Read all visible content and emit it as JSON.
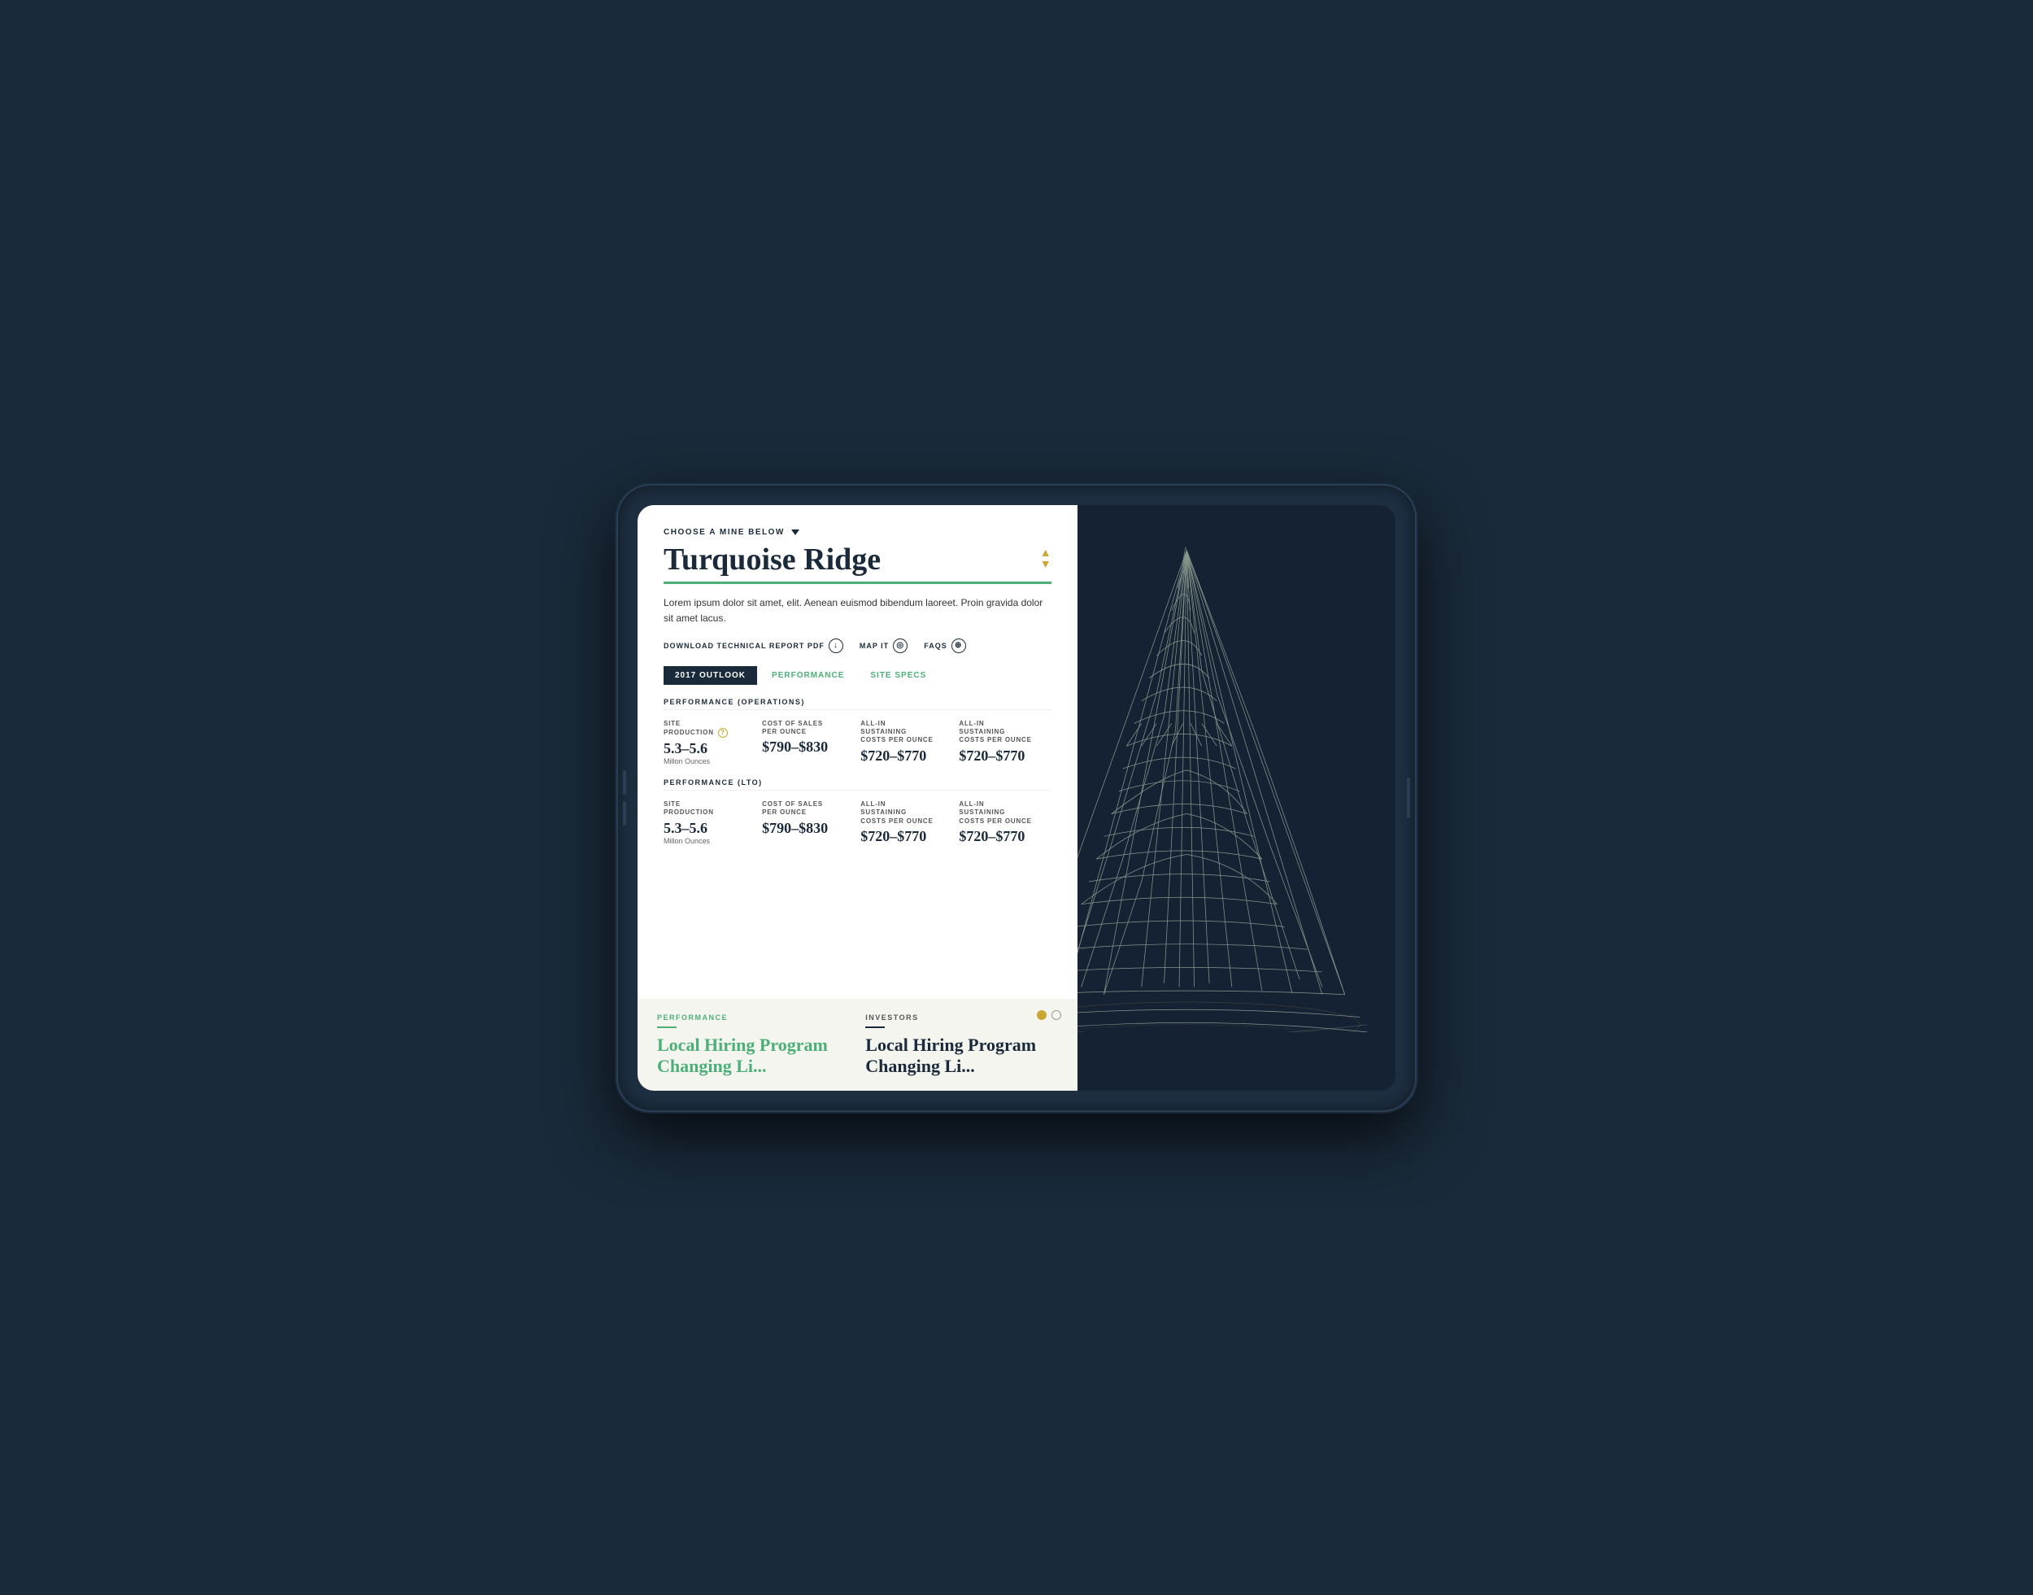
{
  "header": {
    "choose_mine_label": "CHOOSE A MINE BELOW",
    "mine_title": "Turquoise Ridge"
  },
  "description": "Lorem ipsum dolor sit amet, elit. Aenean euismod bibendum laoreet. Proin gravida dolor sit amet lacus.",
  "actions": {
    "download_pdf": "DOWNLOAD TECHNICAL REPORT PDF",
    "map_it": "MAP IT",
    "faqs": "FAQS"
  },
  "tabs": [
    {
      "label": "2017 OUTLOOK",
      "active": true
    },
    {
      "label": "PERFORMANCE",
      "active": false
    },
    {
      "label": "SITE SPECS",
      "active": false
    }
  ],
  "performance_operations": {
    "title": "PERFORMANCE (OPERATIONS)",
    "metrics": [
      {
        "label": "SITE\nPRODUCTION",
        "value": "5.3–5.6",
        "unit": "Millon Ounces",
        "has_info": true
      },
      {
        "label": "COST OF SALES\nPER OUNCE",
        "value": "$790–$830",
        "unit": "",
        "has_info": false
      },
      {
        "label": "ALL-IN\nSUSTAINING\nCOSTS PER OUNCE",
        "value": "$720–$770",
        "unit": "",
        "has_info": false
      },
      {
        "label": "ALL-IN\nSUSTAINING\nCOSTS PER OUNCE",
        "value": "$720–$770",
        "unit": "",
        "has_info": false
      }
    ]
  },
  "performance_lto": {
    "title": "PERFORMANCE (LTO)",
    "metrics": [
      {
        "label": "SITE\nPRODUCTION",
        "value": "5.3–5.6",
        "unit": "Millon Ounces",
        "has_info": false
      },
      {
        "label": "COST OF SALES\nPER OUNCE",
        "value": "$790–$830",
        "unit": "",
        "has_info": false
      },
      {
        "label": "ALL-IN\nSUSTAINING\nCOSTS PER OUNCE",
        "value": "$720–$770",
        "unit": "",
        "has_info": false
      },
      {
        "label": "ALL-IN\nSUSTAINING\nCOSTS PER OUNCE",
        "value": "$720–$770",
        "unit": "",
        "has_info": false
      }
    ]
  },
  "bottom_carousel": {
    "dots": [
      {
        "active": true
      },
      {
        "active": false
      }
    ],
    "items": [
      {
        "category": "PERFORMANCE",
        "title": "Local Hiring Program\nChanging Li...",
        "style": "green"
      },
      {
        "category": "INVESTORS",
        "title": "Local Hiring Program\nChanging Li...",
        "style": "dark"
      }
    ]
  },
  "colors": {
    "accent_green": "#4caf78",
    "accent_gold": "#c8a832",
    "dark_navy": "#1a2a3a",
    "background": "#152234"
  }
}
